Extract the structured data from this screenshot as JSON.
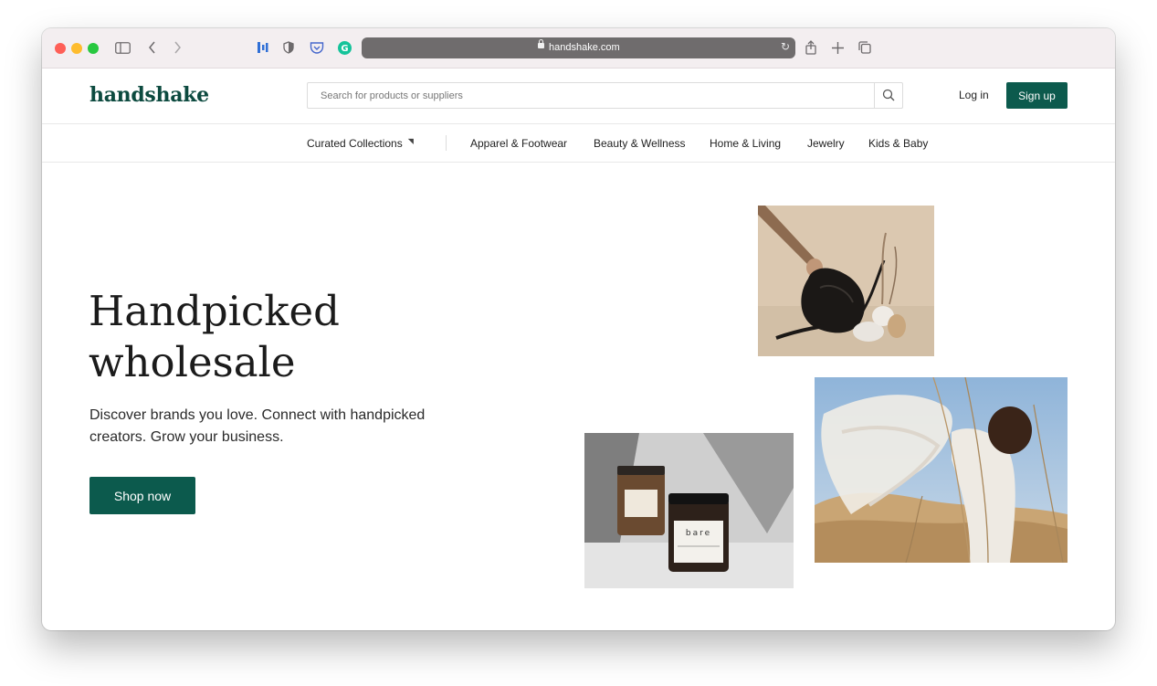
{
  "browser": {
    "url": "handshake.com"
  },
  "site": {
    "logo": "handshake",
    "search_placeholder": "Search for products or suppliers",
    "login_label": "Log in",
    "signup_label": "Sign up"
  },
  "nav": {
    "items": [
      "Curated Collections",
      "Apparel & Footwear",
      "Beauty & Wellness",
      "Home & Living",
      "Jewelry",
      "Kids & Baby"
    ]
  },
  "hero": {
    "title_line1": "Handpicked",
    "title_line2": "wholesale",
    "subtitle": "Discover brands you love. Connect with handpicked creators. Grow your business.",
    "cta_label": "Shop now"
  },
  "images": {
    "jar_label": "bare"
  },
  "colors": {
    "brand_green": "#0c5a4d",
    "logo_green": "#0c4a3f"
  }
}
